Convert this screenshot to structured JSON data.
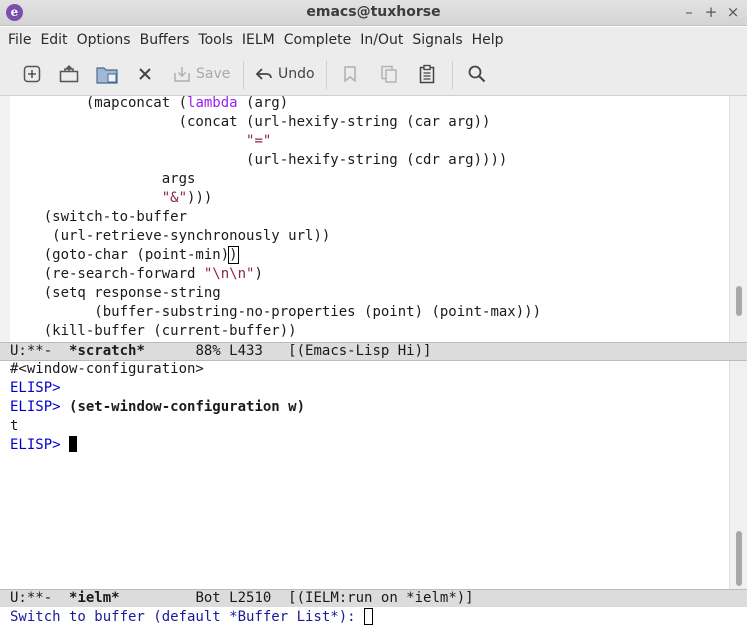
{
  "window": {
    "title": "emacs@tuxhorse",
    "controls": {
      "minimize": "–",
      "maximize": "+",
      "close": "×"
    }
  },
  "menubar": {
    "items": [
      "File",
      "Edit",
      "Options",
      "Buffers",
      "Tools",
      "IELM",
      "Complete",
      "In/Out",
      "Signals",
      "Help"
    ]
  },
  "toolbar": {
    "new_file_icon": "new-file-icon",
    "open_icon": "folder-open-icon",
    "dired_icon": "directory-icon",
    "close_icon": "close-icon",
    "save_label": "Save",
    "undo_label": "Undo",
    "cut_icon": "cut-icon",
    "copy_icon": "copy-icon",
    "paste_icon": "paste-icon",
    "search_icon": "search-icon"
  },
  "editor": {
    "lines": [
      {
        "indent": "         ",
        "parts": [
          {
            "t": "(mapconcat ("
          },
          {
            "t": "lambda",
            "c": "kw"
          },
          {
            "t": " (arg)"
          }
        ]
      },
      {
        "indent": "                    ",
        "parts": [
          {
            "t": "(concat (url-hexify-string (car arg))"
          }
        ]
      },
      {
        "indent": "                            ",
        "parts": [
          {
            "t": "\"=\"",
            "c": "str"
          }
        ]
      },
      {
        "indent": "                            ",
        "parts": [
          {
            "t": "(url-hexify-string (cdr arg))))"
          }
        ]
      },
      {
        "indent": "                  ",
        "parts": [
          {
            "t": "args"
          }
        ]
      },
      {
        "indent": "                  ",
        "parts": [
          {
            "t": "\"&\"",
            "c": "str"
          },
          {
            "t": ")))"
          }
        ]
      },
      {
        "indent": "    ",
        "parts": [
          {
            "t": "(switch-to-buffer"
          }
        ]
      },
      {
        "indent": "     ",
        "parts": [
          {
            "t": "(url-retrieve-synchronously url))"
          }
        ]
      },
      {
        "indent": "    ",
        "parts": [
          {
            "t": "(goto-char (point-min)"
          },
          {
            "t": ")",
            "c": "cursor-box"
          }
        ]
      },
      {
        "indent": "    ",
        "parts": [
          {
            "t": "(re-search-forward "
          },
          {
            "t": "\"\\n\\n\"",
            "c": "str"
          },
          {
            "t": ")"
          }
        ]
      },
      {
        "indent": "    ",
        "parts": [
          {
            "t": "(setq response-string"
          }
        ]
      },
      {
        "indent": "          ",
        "parts": [
          {
            "t": "(buffer-substring-no-properties (point) (point-max)))"
          }
        ]
      },
      {
        "indent": "    ",
        "parts": [
          {
            "t": "(kill-buffer (current-buffer))"
          }
        ]
      }
    ]
  },
  "modeline_top": {
    "status": "U:**-  ",
    "buffer": "*scratch*",
    "position": "      88% L433   ",
    "mode": "[(Emacs-Lisp Hi)]"
  },
  "repl": {
    "result_line": "#<window-configuration>",
    "prompt": "ELISP>",
    "input": "(set-window-configuration w)",
    "output": "t"
  },
  "modeline_bottom": {
    "status": "U:**-  ",
    "buffer": "*ielm*",
    "position": "         Bot L2510  ",
    "mode": "[(IELM:run on *ielm*)]"
  },
  "minibuffer": {
    "prompt": "Switch to buffer (default *Buffer List*): "
  }
}
